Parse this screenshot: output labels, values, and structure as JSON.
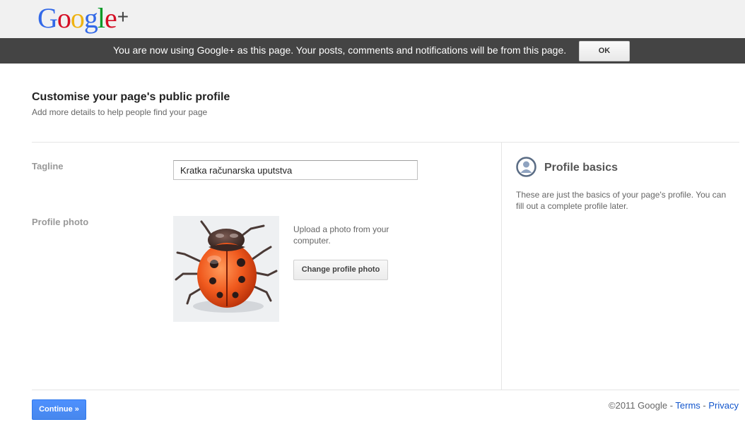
{
  "header": {
    "logo_text": "Google",
    "logo_plus": "+",
    "logo_colors": [
      "#3369e8",
      "#d50f25",
      "#eeb211",
      "#3369e8",
      "#009925",
      "#d50f25"
    ]
  },
  "notice": {
    "text": "You are now using Google+ as this page. Your posts, comments and notifications will be from this page.",
    "ok_label": "OK"
  },
  "main": {
    "title": "Customise your page's public profile",
    "subtitle": "Add more details to help people find your page",
    "tagline": {
      "label": "Tagline",
      "value": "Kratka računarska uputstva"
    },
    "profile_photo": {
      "label": "Profile photo",
      "image": "ladybug",
      "upload_text": "Upload a photo from your computer.",
      "change_label": "Change profile photo"
    },
    "continue_label": "Continue »"
  },
  "sidebar": {
    "icon": "profile-icon",
    "title": "Profile basics",
    "text": "These are just the basics of your page's profile. You can fill out a complete profile later."
  },
  "footer": {
    "copyright": "©2011 Google",
    "sep1": " - ",
    "terms": "Terms",
    "sep2": " - ",
    "privacy": "Privacy"
  },
  "colors": {
    "accent_blue": "#4d90fe",
    "link": "#1155cc",
    "notice_bg": "#444444"
  }
}
